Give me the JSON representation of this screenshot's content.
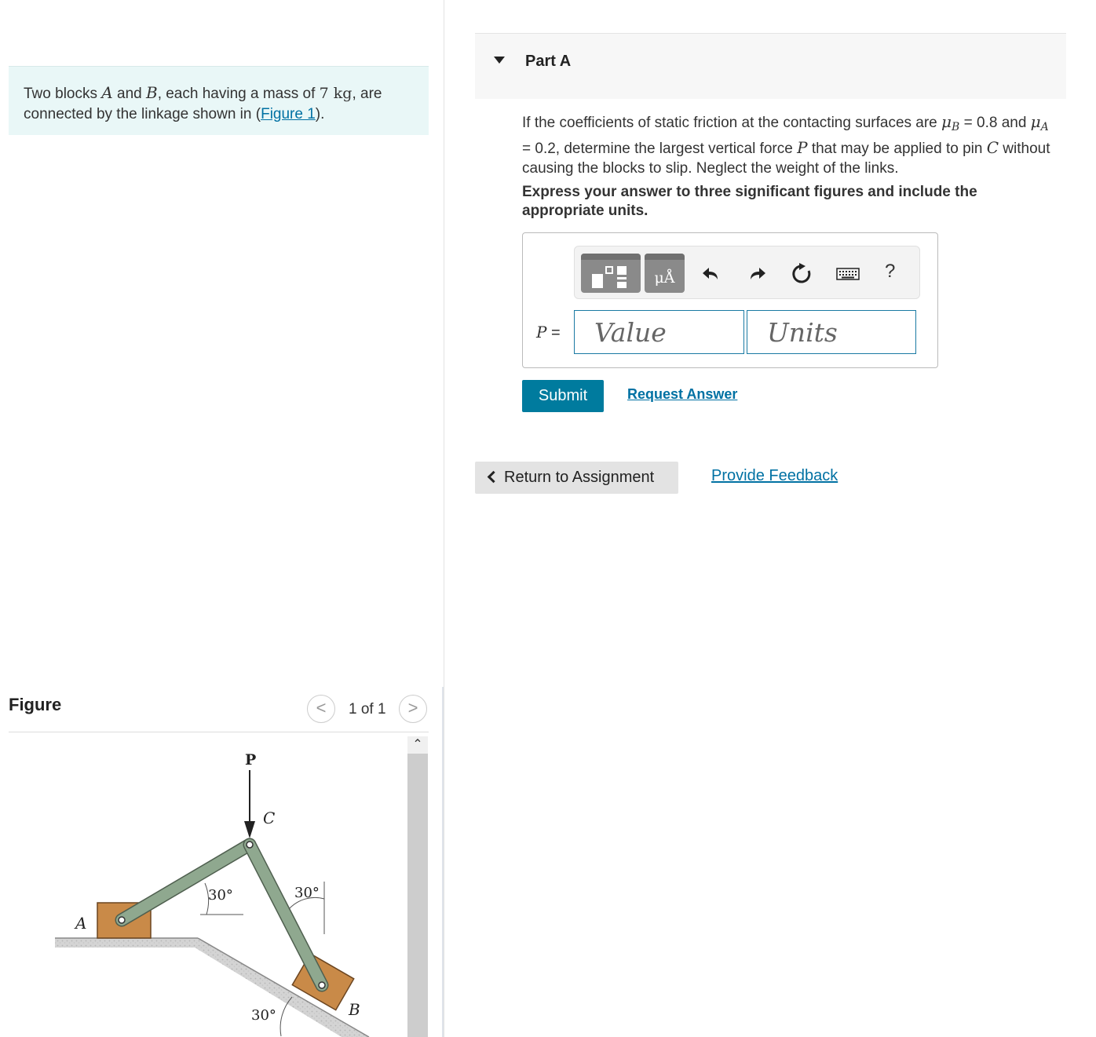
{
  "problem": {
    "text_1": "Two blocks ",
    "var_a": "A",
    "text_2": " and ",
    "var_b": "B",
    "text_3": ", each having a mass of ",
    "mass": "7 kg",
    "text_4": ", are connected by the linkage shown in (",
    "figure_link": "Figure 1",
    "text_5": ")."
  },
  "figure_panel": {
    "title": "Figure",
    "counter": "1 of 1",
    "prev_glyph": "<",
    "next_glyph": ">",
    "scroll_up_glyph": "^",
    "labels": {
      "force": "P",
      "pin": "C",
      "block_a": "A",
      "block_b": "B",
      "angle_link_ac": "30°",
      "angle_link_cb": "30°",
      "angle_incline": "30°"
    },
    "colors": {
      "link": "#8fa88f",
      "block": "#c98a48",
      "ground": "#d8d8d8"
    }
  },
  "part": {
    "title": "Part A",
    "question_1": "If the coefficients of static friction at the contacting surfaces are ",
    "mu_b_sym": "μ",
    "mu_b_sub": "B",
    "mu_b_val": " = 0.8 and ",
    "mu_a_sym": "μ",
    "mu_a_sub": "A",
    "mu_a_val": " = 0.2, determine the largest vertical force ",
    "force_var": "P",
    "question_2": " that may be applied to pin ",
    "pin_var": "C",
    "question_3": " without causing the blocks to slip. Neglect the weight of the links.",
    "instructions": "Express your answer to three significant figures and include the appropriate units."
  },
  "answer": {
    "label_var": "P",
    "label_eq": " =",
    "value_placeholder": "Value",
    "units_placeholder": "Units",
    "toolbar": {
      "units_glyph": "μÅ",
      "icons": [
        "templates-icon",
        "units-icon",
        "undo-icon",
        "redo-icon",
        "reset-icon",
        "keyboard-icon",
        "help-icon"
      ],
      "help": "?"
    }
  },
  "actions": {
    "submit": "Submit",
    "request_answer": "Request Answer",
    "return": "Return to Assignment",
    "feedback": "Provide Feedback"
  },
  "colors": {
    "accent": "#007b9e",
    "link": "#0071a3",
    "problem_bg": "#e9f7f7"
  }
}
